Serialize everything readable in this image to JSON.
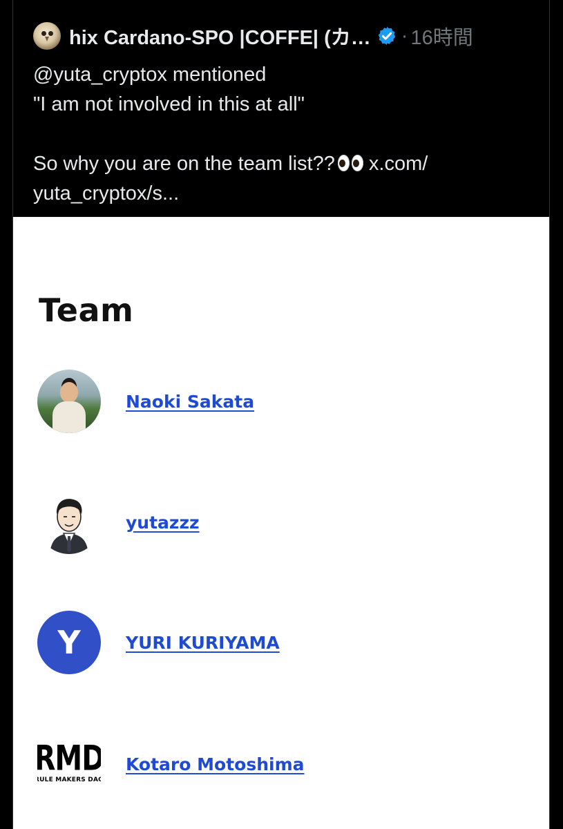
{
  "tweet": {
    "author_name": "hix Cardano-SPO |COFFE| (カ…",
    "separator": "·",
    "time": "16時間",
    "text_lines": [
      "@yuta_cryptox mentioned",
      "\"I am not involved in this at all\"",
      "",
      "So why you are on the team list??",
      "yuta_cryptox/s..."
    ],
    "link_tail": "x.com/",
    "emoji": "eyes-emoji"
  },
  "media": {
    "heading": "Team",
    "members": [
      {
        "name": "Naoki Sakata",
        "avatar": "photo"
      },
      {
        "name": "yutazzz",
        "avatar": "sketch"
      },
      {
        "name": "YURI KURIYAMA",
        "avatar": "letter",
        "avatar_letter": "Y"
      },
      {
        "name": "Kotaro Motoshima",
        "avatar": "logo",
        "logo_main": "RMD",
        "logo_sub": "RULE MAKERS DAO"
      }
    ]
  },
  "colors": {
    "background": "#000000",
    "text": "#e7e9ea",
    "muted": "#71767b",
    "verified": "#1d9bf0",
    "link": "#1f4bd2",
    "letter_avatar": "#3150c7"
  }
}
